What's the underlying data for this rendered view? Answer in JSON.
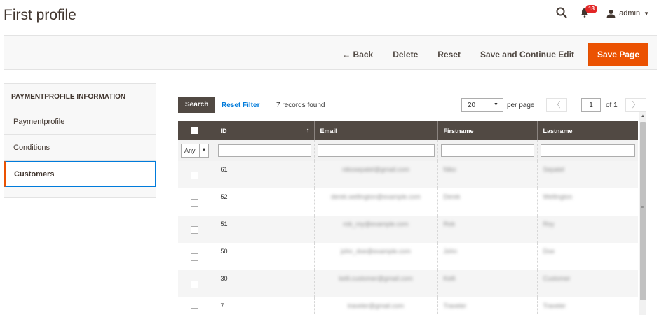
{
  "header": {
    "title": "First profile",
    "notifications_count": "18",
    "user_name": "admin"
  },
  "action_bar": {
    "back_label": "← Back",
    "delete_label": "Delete",
    "reset_label": "Reset",
    "save_continue_label": "Save and Continue Edit",
    "save_label": "Save Page"
  },
  "sidebar": {
    "title": "PAYMENTPROFILE INFORMATION",
    "items": [
      {
        "label": "Paymentprofile"
      },
      {
        "label": "Conditions"
      },
      {
        "label": "Customers",
        "active": true
      }
    ]
  },
  "grid_toolbar": {
    "search_label": "Search",
    "reset_filter_label": "Reset Filter",
    "records_found": "7 records found",
    "per_page_value": "20",
    "per_page_label": "per page",
    "current_page": "1",
    "page_total": "of 1"
  },
  "table": {
    "columns": [
      "ID",
      "Email",
      "Firstname",
      "Lastname"
    ],
    "sort_indicator": "↑",
    "filter_select_value": "Any",
    "rows": [
      {
        "id": "61",
        "email": "nikosepatel@gmail.com",
        "firstname": "Niko",
        "lastname": "Sepatel"
      },
      {
        "id": "52",
        "email": "derek.wellington@example.com",
        "firstname": "Derek",
        "lastname": "Wellington"
      },
      {
        "id": "51",
        "email": "rob_roy@example.com",
        "firstname": "Rob",
        "lastname": "Roy"
      },
      {
        "id": "50",
        "email": "john_doe@example.com",
        "firstname": "John",
        "lastname": "Doe"
      },
      {
        "id": "30",
        "email": "kelli.customer@gmail.com",
        "firstname": "Kelli",
        "lastname": "Customer"
      },
      {
        "id": "7",
        "email": "traveler@gmail.com",
        "firstname": "Traveler",
        "lastname": "Traveler"
      }
    ]
  },
  "colors": {
    "accent": "#eb5202",
    "header_dark": "#514943",
    "link": "#007bdb"
  }
}
